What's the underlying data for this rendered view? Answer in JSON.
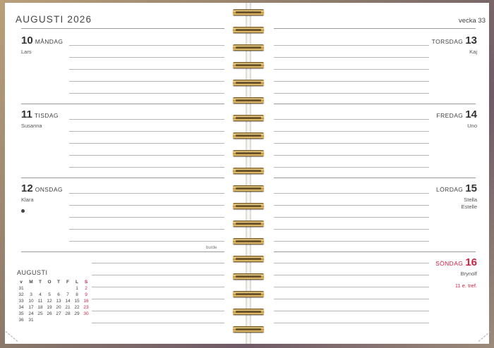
{
  "header": {
    "month_title": "AUGUSTI 2026",
    "week": "vecka 33"
  },
  "days": {
    "mon": {
      "num": "10",
      "name": "MÅNDAG",
      "names": "Lars"
    },
    "tue": {
      "num": "11",
      "name": "TISDAG",
      "names": "Susanna"
    },
    "wed": {
      "num": "12",
      "name": "ONSDAG",
      "names": "Klara"
    },
    "thu": {
      "num": "13",
      "name": "TORSDAG",
      "names": "Kaj"
    },
    "fri": {
      "num": "14",
      "name": "FREDAG",
      "names": "Uno"
    },
    "sat": {
      "num": "15",
      "name": "LÖRDAG",
      "names": "Stella\nEstelle"
    },
    "sun": {
      "num": "16",
      "name": "SÖNDAG",
      "names": "Brynolf",
      "note": "11 e. tref."
    }
  },
  "brand": "burde",
  "mini_calendar": {
    "title": "AUGUSTI",
    "headers": [
      "v",
      "M",
      "T",
      "O",
      "T",
      "F",
      "L",
      "S"
    ],
    "rows": [
      [
        "31",
        "",
        "",
        "",
        "",
        "",
        "1",
        "2"
      ],
      [
        "32",
        "3",
        "4",
        "5",
        "6",
        "7",
        "8",
        "9"
      ],
      [
        "33",
        "10",
        "11",
        "12",
        "13",
        "14",
        "15",
        "16"
      ],
      [
        "34",
        "17",
        "18",
        "19",
        "20",
        "21",
        "22",
        "23"
      ],
      [
        "35",
        "24",
        "25",
        "26",
        "27",
        "28",
        "29",
        "30"
      ],
      [
        "36",
        "31",
        "",
        "",
        "",
        "",
        "",
        ""
      ]
    ]
  },
  "colors": {
    "sunday_red": "#cc2244",
    "text": "#333333"
  }
}
